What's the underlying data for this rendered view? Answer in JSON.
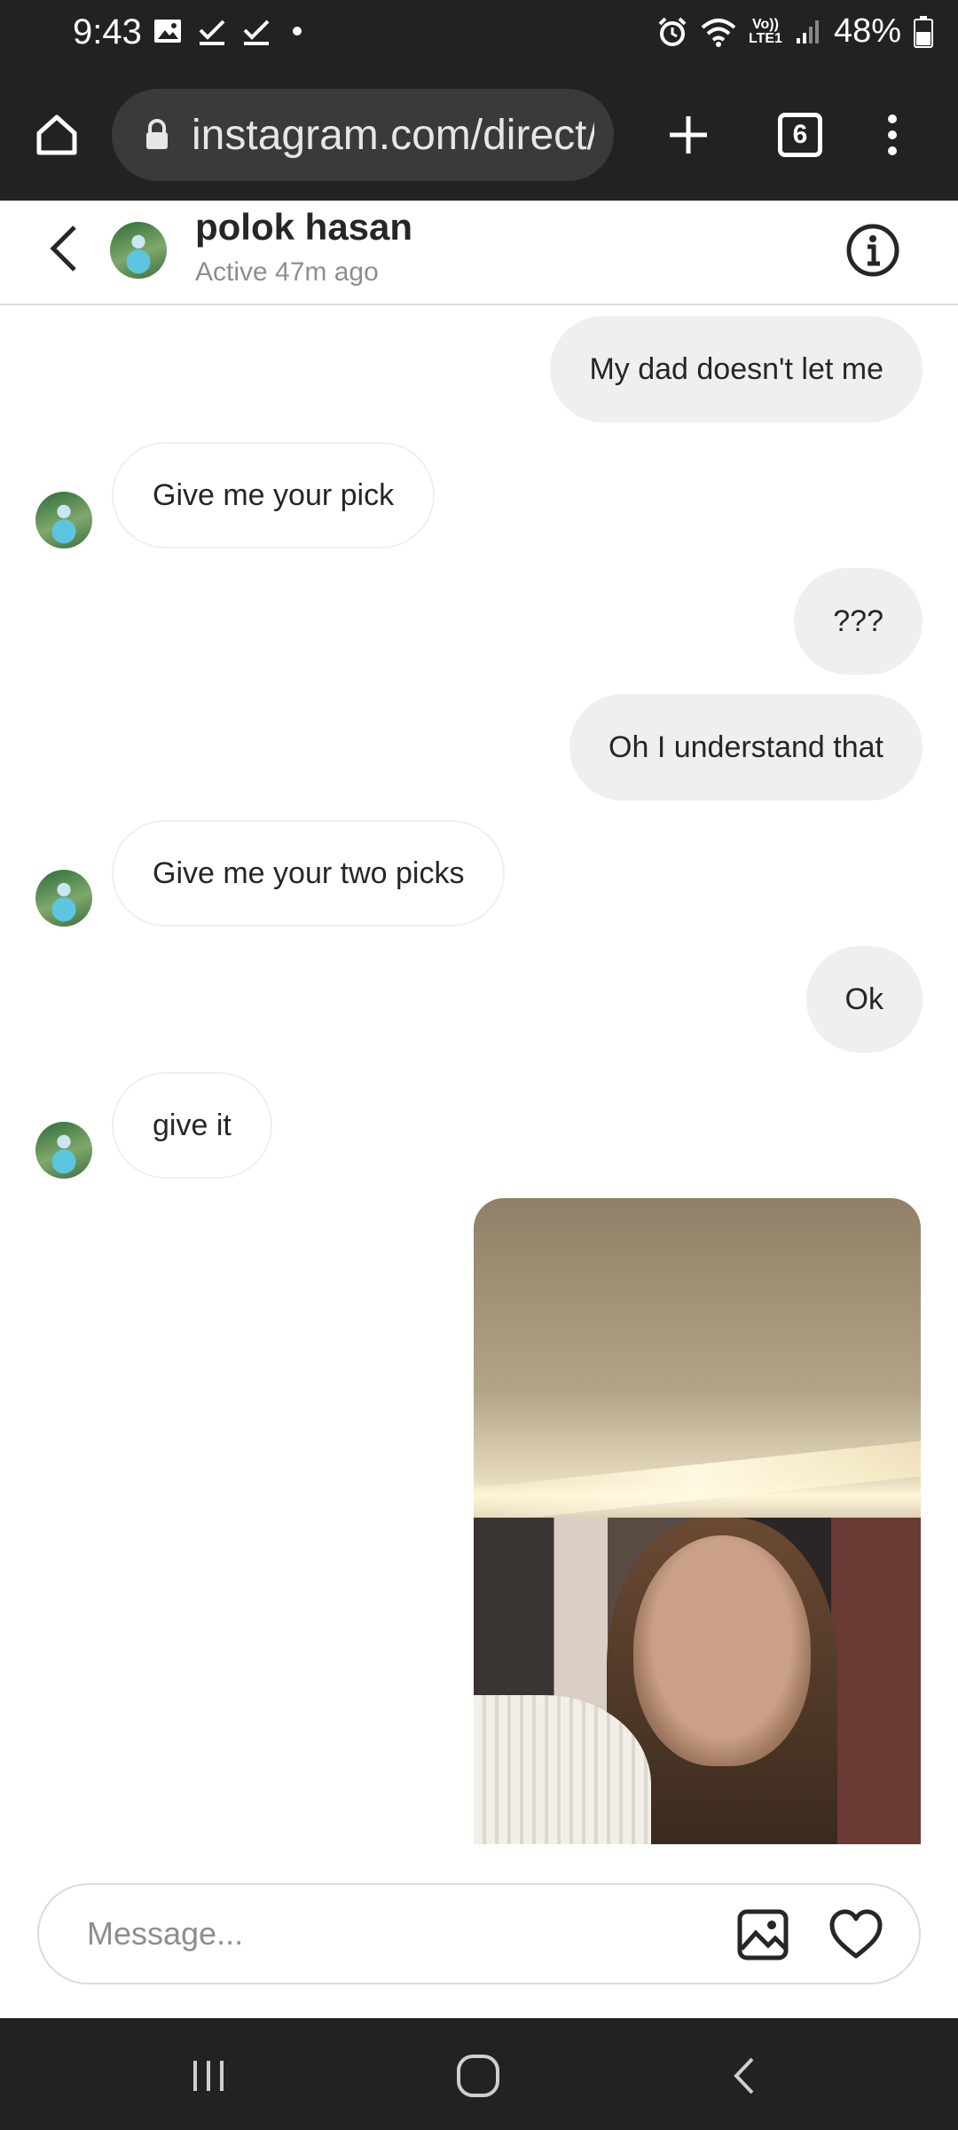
{
  "status_bar": {
    "time": "9:43",
    "left_icons": [
      "image-icon",
      "check-icon",
      "check-icon",
      "dot-icon"
    ],
    "network_badge_line1": "Vo))",
    "network_badge_line2": "LTE1",
    "battery_percent": "48%"
  },
  "browser": {
    "url": "instagram.com/direct/",
    "tab_count": "6"
  },
  "chat": {
    "contact_name": "polok hasan",
    "contact_status": "Active 47m ago"
  },
  "messages": [
    {
      "direction": "out",
      "text": "My dad doesn't let me"
    },
    {
      "direction": "in",
      "text": "Give me your pick"
    },
    {
      "direction": "out",
      "text": "???"
    },
    {
      "direction": "out",
      "text": "Oh I understand that"
    },
    {
      "direction": "in",
      "text": "Give me your two picks"
    },
    {
      "direction": "out",
      "text": "Ok"
    },
    {
      "direction": "in",
      "text": "give it"
    },
    {
      "direction": "out",
      "type": "photo"
    }
  ],
  "composer": {
    "placeholder": "Message..."
  },
  "colors": {
    "system_bar": "#222222",
    "outgoing_bubble": "#efefef",
    "secondary_text": "#8e8e8e"
  }
}
